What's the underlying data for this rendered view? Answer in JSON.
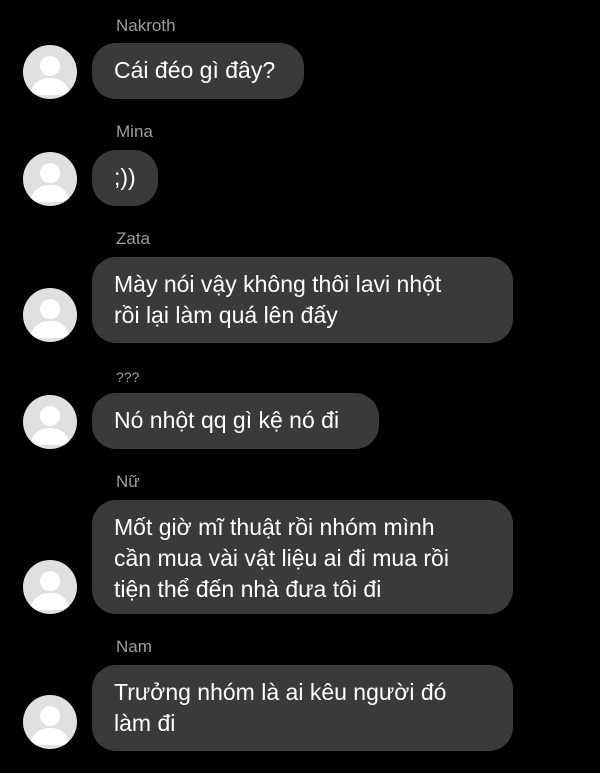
{
  "messages": [
    {
      "sender": "Nakroth",
      "lines": [
        "Cái đéo gì đây?"
      ]
    },
    {
      "sender": "Mina",
      "lines": [
        ";))"
      ]
    },
    {
      "sender": "Zata",
      "lines": [
        "Mày nói vậy không thôi lavi nhột",
        "rồi lại làm quá lên đấy"
      ]
    },
    {
      "sender": "???",
      "lines": [
        "Nó nhột qq gì kệ nó đi"
      ]
    },
    {
      "sender": "Nữ",
      "lines": [
        "Mốt giờ mĩ thuật rồi nhóm mình",
        "cần mua vài vật liệu ai đi mua rồi",
        "tiện thể đến nhà đưa tôi đi"
      ]
    },
    {
      "sender": "Nam",
      "lines": [
        "Trưởng nhóm là ai kêu người đó",
        "làm đi"
      ]
    }
  ],
  "icons": {
    "avatar": "default-user-avatar-icon"
  },
  "colors": {
    "background": "#000000",
    "bubble": "#3a3a3c",
    "sender_text": "#9e9e9e",
    "message_text": "#ffffff",
    "avatar_bg": "#e0e0e0",
    "avatar_figure": "#ffffff"
  }
}
